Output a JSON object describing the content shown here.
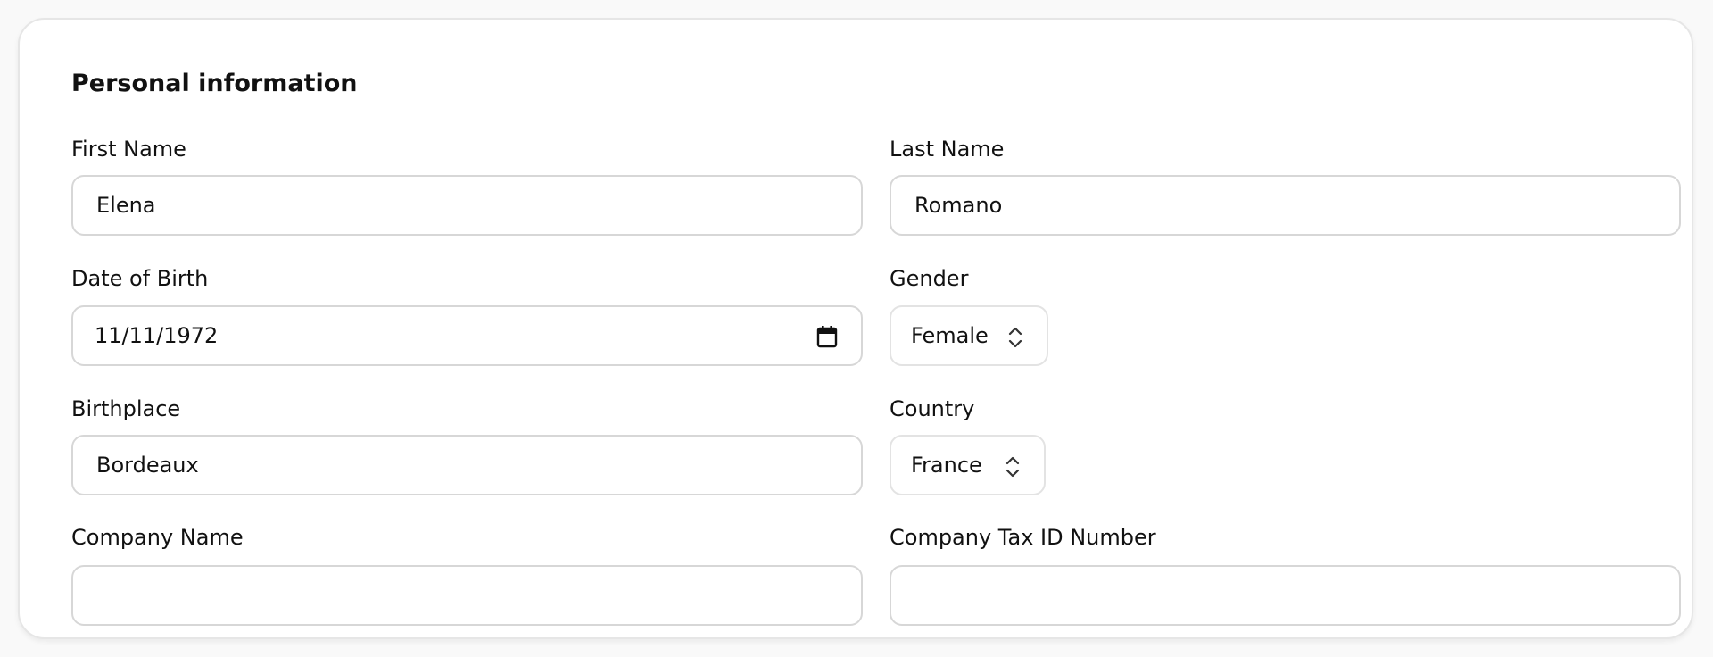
{
  "section": {
    "title": "Personal information"
  },
  "fields": {
    "first_name": {
      "label": "First Name",
      "value": "Elena"
    },
    "last_name": {
      "label": "Last Name",
      "value": "Romano"
    },
    "date_of_birth": {
      "label": "Date of Birth",
      "value": "11/11/1972",
      "icon": "calendar-icon"
    },
    "gender": {
      "label": "Gender",
      "value": "Female",
      "icon": "chevron-up-down-icon"
    },
    "birthplace": {
      "label": "Birthplace",
      "value": "Bordeaux"
    },
    "country": {
      "label": "Country",
      "value": "France",
      "icon": "chevron-up-down-icon"
    },
    "company_name": {
      "label": "Company Name",
      "value": ""
    },
    "company_tax_id": {
      "label": "Company Tax ID Number",
      "value": ""
    }
  },
  "colors": {
    "card_border": "#e6e6e6",
    "input_border": "#d7d7d7",
    "text": "#111111",
    "page_background": "#f9f9f9"
  }
}
